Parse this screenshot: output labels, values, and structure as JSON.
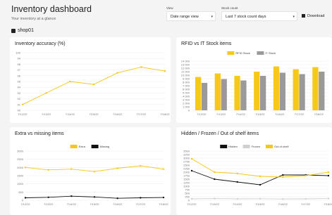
{
  "header": {
    "title": "Inventory dashboard",
    "subtitle": "Your inventory at a glance",
    "view_label": "View",
    "view_value": "Date range view",
    "stock_count_label": "Stock count",
    "stock_count_value": "Last 7 stock count days",
    "download_label": "Download"
  },
  "shop": {
    "name": "shop01",
    "icon": "store-icon"
  },
  "colors": {
    "yellow": "#f5c81a",
    "gray": "#9a9a9a",
    "black": "#111111",
    "light": "#d0d0d0"
  },
  "charts": {
    "accuracy": {
      "title": "Inventory accuracy (%)",
      "chart_data": {
        "type": "line",
        "categories": [
          "7/12/22",
          "7/13/22",
          "7/14/22",
          "7/15/22",
          "7/16/22",
          "7/17/22",
          "7/18/22"
        ],
        "series": [
          {
            "values": [
              91,
              93,
              95,
              94.5,
              96.5,
              97.5,
              96.8
            ]
          }
        ],
        "ylim": [
          90,
          100
        ],
        "yticks": [
          90,
          91,
          92,
          93,
          94,
          95,
          96,
          97,
          98,
          99,
          100
        ],
        "grid": true
      }
    },
    "rfid": {
      "title": "RFID vs IT Stock items",
      "chart_data": {
        "type": "bar",
        "categories": [
          "7/12/22",
          "7/13/22",
          "7/14/22",
          "7/15/22",
          "7/16/22",
          "7/17/22",
          "7/18/22"
        ],
        "series": [
          {
            "name": "RFID Stock",
            "values": [
              9500,
              10500,
              9800,
              11000,
              12500,
              11700,
              12300
            ]
          },
          {
            "name": "IT Stock",
            "values": [
              7800,
              8900,
              8500,
              9800,
              10700,
              10300,
              11000
            ]
          }
        ],
        "ylim": [
          0,
          14000
        ],
        "yticks": [
          0,
          1000,
          2000,
          3000,
          4000,
          5000,
          6000,
          7000,
          8000,
          9000,
          10000,
          11000,
          12000,
          13000,
          14000
        ],
        "ytick_labels": [
          "0",
          "1 000",
          "2 000",
          "3 000",
          "4 000",
          "5 000",
          "6 000",
          "7 000",
          "8 000",
          "9 000",
          "10 000",
          "11 000",
          "12 000",
          "13 000",
          "14 000"
        ],
        "legend": "top-center",
        "grid": true
      }
    },
    "extra": {
      "title": "Extra vs missing items",
      "chart_data": {
        "type": "line",
        "categories": [
          "7/12/22",
          "7/13/22",
          "7/14/22",
          "7/15/22",
          "7/16/22",
          "7/17/22",
          "7/18/22"
        ],
        "series": [
          {
            "name": "Extra",
            "values": [
              2000,
              1850,
              1900,
              1750,
              1950,
              2100,
              1900
            ]
          },
          {
            "name": "Missing",
            "values": [
              150,
              180,
              250,
              200,
              120,
              150,
              170
            ]
          }
        ],
        "ylim": [
          0,
          3000
        ],
        "yticks": [
          0,
          500,
          1000,
          1500,
          2000,
          2500,
          3000
        ],
        "legend": "top-center",
        "grid": true
      }
    },
    "hidden": {
      "title": "Hidden / Frozen / Out of shelf items",
      "chart_data": {
        "type": "line",
        "categories": [
          "7/12/22",
          "7/13/22",
          "7/14/22",
          "7/15/22",
          "7/16/22",
          "7/17/22",
          "7/18/22"
        ],
        "series": [
          {
            "name": "Hidden",
            "values": [
              2100,
              1500,
              1300,
              1100,
              1800,
              1800,
              1750
            ]
          },
          {
            "name": "Frozen",
            "values": [
              100,
              120,
              100,
              110,
              90,
              100,
              120
            ]
          },
          {
            "name": "Out of shelf",
            "values": [
              2950,
              2000,
              1900,
              1700,
              1650,
              1750,
              2000
            ]
          }
        ],
        "ylim": [
          0,
          3500
        ],
        "yticks": [
          0,
          250,
          500,
          750,
          1000,
          1250,
          1500,
          1750,
          2000,
          2250,
          2500,
          2750,
          3000,
          3250,
          3500
        ],
        "legend": "top-center",
        "grid": true
      }
    }
  }
}
